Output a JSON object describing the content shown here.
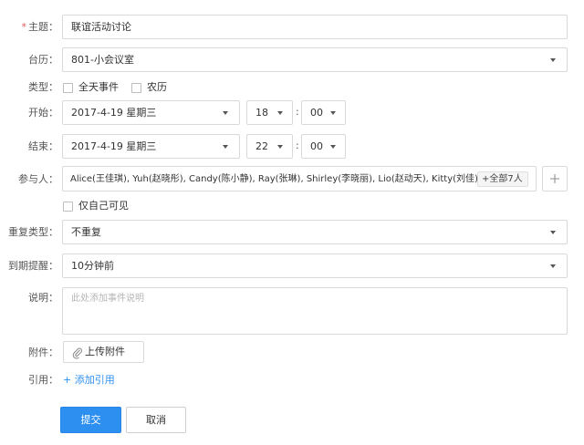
{
  "form": {
    "subject": {
      "label": "主题：",
      "value": "联谊活动讨论"
    },
    "calendar": {
      "label": "台历：",
      "value": "801-小会议室"
    },
    "type": {
      "label": "类型：",
      "all_day": "全天事件",
      "lunar": "农历"
    },
    "start": {
      "label": "开始：",
      "date": "2017-4-19 星期三",
      "hour": "18",
      "minute": "00"
    },
    "end": {
      "label": "结束：",
      "date": "2017-4-19 星期三",
      "hour": "22",
      "minute": "00"
    },
    "time_separator": ":",
    "participants": {
      "label": "参与人：",
      "value": "Alice(王佳琪), Yuh(赵晓彤), Candy(陈小静), Ray(张琳), Shirley(李晓丽), Lio(赵动天), Kitty(刘佳)",
      "all_badge": "+全部7人",
      "add_icon": "plus-icon",
      "only_me_visible": "仅自己可见"
    },
    "repeat": {
      "label": "重复类型：",
      "value": "不重复"
    },
    "reminder": {
      "label": "到期提醒：",
      "value": "10分钟前"
    },
    "description": {
      "label": "说明：",
      "placeholder": "此处添加事件说明"
    },
    "attachment": {
      "label": "附件：",
      "button": "上传附件",
      "icon": "paperclip-icon"
    },
    "reference": {
      "label": "引用：",
      "link": "+ 添加引用"
    },
    "actions": {
      "submit": "提交",
      "cancel": "取消"
    }
  },
  "colors": {
    "primary": "#2d8ff0",
    "required": "#e05a5a",
    "border": "#d9d9d9"
  }
}
